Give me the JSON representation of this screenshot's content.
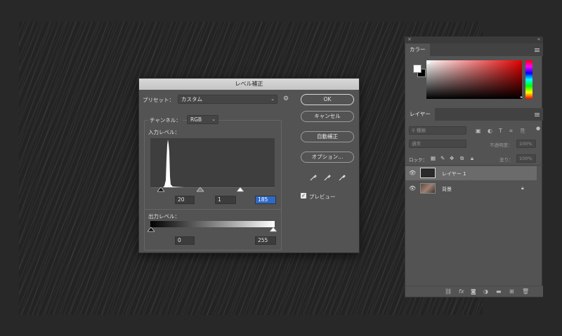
{
  "dialog": {
    "title": "レベル補正",
    "preset_label": "プリセット：",
    "preset_value": "カスタム",
    "channel_label": "チャンネル：",
    "channel_value": "RGB",
    "input_levels_label": "入力レベル：",
    "input_black": "20",
    "input_gamma": "1",
    "input_white": "185",
    "output_levels_label": "出力レベル：",
    "output_black": "0",
    "output_white": "255",
    "buttons": {
      "ok": "OK",
      "cancel": "キャンセル",
      "auto": "自動補正",
      "options": "オプション..."
    },
    "preview_label": "プレビュー",
    "preview_checked": true
  },
  "color_panel": {
    "tab": "カラー",
    "foreground": "#ffffff",
    "background": "#000000"
  },
  "layers_panel": {
    "tab": "レイヤー",
    "filter_label": "種類",
    "blend_mode": "通常",
    "opacity_label": "不透明度：",
    "opacity_value": "100%",
    "lock_label": "ロック：",
    "fill_label": "塗り：",
    "fill_value": "100%",
    "layers": [
      {
        "name": "レイヤー 1",
        "selected": true,
        "locked": false
      },
      {
        "name": "背景",
        "selected": false,
        "locked": true
      }
    ]
  },
  "icons": {
    "gear": "gear-icon",
    "eyedroppers": [
      "black-eyedropper-icon",
      "gray-eyedropper-icon",
      "white-eyedropper-icon"
    ],
    "visibility": "eye-icon",
    "lock": "lock-icon"
  }
}
